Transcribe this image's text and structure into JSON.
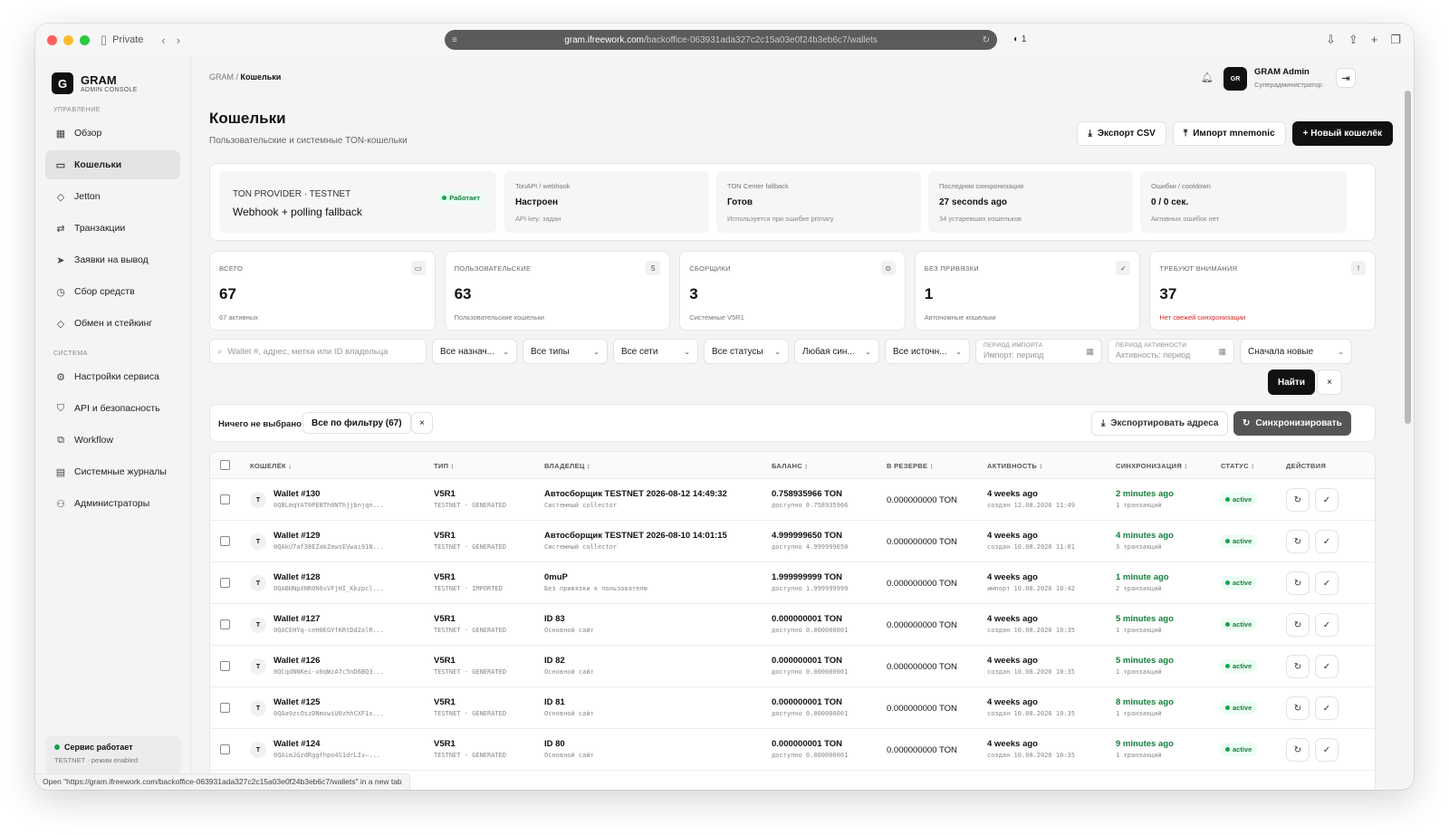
{
  "browser": {
    "private_label": "Private",
    "url_host": "gram.ifreework.com",
    "url_path": "/backoffice-063931ada327c2c15a03e0f24b3eb6c7/wallets",
    "ext_badge": "1",
    "hover_url": "Open \"https://gram.ifreework.com/backoffice-063931ada327c2c15a03e0f24b3eb6c7/wallets\" in a new tab"
  },
  "brand": {
    "letter": "G",
    "name": "GRAM",
    "sub": "ADMIN CONSOLE"
  },
  "sidebar": {
    "section1": "УПРАВЛЕНИЕ",
    "items1": [
      {
        "label": "Обзор",
        "icon": "grid-icon"
      },
      {
        "label": "Кошельки",
        "icon": "wallet-icon"
      },
      {
        "label": "Jetton",
        "icon": "diamond-icon"
      },
      {
        "label": "Транзакции",
        "icon": "arrows-icon"
      },
      {
        "label": "Заявки на вывод",
        "icon": "send-icon"
      },
      {
        "label": "Сбор средств",
        "icon": "clock-icon"
      },
      {
        "label": "Обмен и стейкинг",
        "icon": "diamond-icon"
      }
    ],
    "section2": "СИСТЕМА",
    "items2": [
      {
        "label": "Настройки сервиса",
        "icon": "gear-icon"
      },
      {
        "label": "API и безопасность",
        "icon": "shield-icon"
      },
      {
        "label": "Workflow",
        "icon": "workflow-icon"
      },
      {
        "label": "Системные журналы",
        "icon": "document-icon"
      },
      {
        "label": "Администраторы",
        "icon": "users-icon"
      }
    ],
    "service": {
      "title": "Сервис работает",
      "sub": "TESTNET · режим enabled"
    }
  },
  "header": {
    "breadcrumb_root": "GRAM / ",
    "breadcrumb_current": "Кошельки",
    "user_initials": "GR",
    "user_name": "GRAM Admin",
    "user_role": "Суперадминистратор"
  },
  "page": {
    "title": "Кошельки",
    "subtitle": "Пользовательские и системные TON-кошельки",
    "export_csv": "Экспорт CSV",
    "import_mnemonic": "Импорт mnemonic",
    "new_wallet": "+ Новый кошелёк"
  },
  "provider": {
    "label": "TON PROVIDER · TESTNET",
    "desc": "Webhook + polling fallback",
    "badge": "Работает",
    "cells": [
      {
        "label": "TonAPI / webhook",
        "value": "Настроен",
        "sub": "API key: задан"
      },
      {
        "label": "TON Center fallback",
        "value": "Готов",
        "sub": "Используется при ошибке primary"
      },
      {
        "label": "Последняя синхронизация",
        "value": "27 seconds ago",
        "sub": "34 устаревших кошельков"
      },
      {
        "label": "Ошибки / cooldown",
        "value": "0 / 0 сек.",
        "sub": "Активных ошибок нет"
      }
    ]
  },
  "stats": [
    {
      "label": "ВСЕГО",
      "value": "67",
      "sub": "67 активных",
      "icon": "wallet-icon",
      "glyph": "▭"
    },
    {
      "label": "ПОЛЬЗОВАТЕЛЬСКИЕ",
      "value": "63",
      "sub": "Пользовательские кошельки",
      "icon": "count-badge",
      "glyph": "5"
    },
    {
      "label": "СБОРЩИКИ",
      "value": "3",
      "sub": "Системные V5R1",
      "icon": "target-icon",
      "glyph": "⊙"
    },
    {
      "label": "БЕЗ ПРИВЯЗКИ",
      "value": "1",
      "sub": "Автономные кошельки",
      "icon": "check-icon",
      "glyph": "✓"
    },
    {
      "label": "ТРЕБУЮТ ВНИМАНИЯ",
      "value": "37",
      "sub": "Нет свежей синхронизации",
      "icon": "alert-icon",
      "glyph": "!"
    }
  ],
  "filters": {
    "search_placeholder": "Wallet #, адрес, метка или ID владельца",
    "selects": [
      "Все назнач...",
      "Все типы",
      "Все сети",
      "Все статусы",
      "Любая син...",
      "Все источн..."
    ],
    "import_label": "ПЕРИОД ИМПОРТА",
    "import_placeholder": "Импорт: период",
    "activity_label": "ПЕРИОД АКТИВНОСТИ",
    "activity_placeholder": "Активность: период",
    "sort": "Сначала новые",
    "find": "Найти",
    "clear": "×"
  },
  "selection": {
    "none": "Ничего не выбрано",
    "all_by_filter": "Все по фильтру (67)",
    "clear": "×",
    "export_addresses": "Экспортировать адреса",
    "sync": "Синхронизировать"
  },
  "table": {
    "headers": {
      "wallet": "КОШЕЛЁК ↓",
      "type": "ТИП ↕",
      "owner": "ВЛАДЕЛЕЦ ↕",
      "balance": "БАЛАНС ↕",
      "reserve": "В РЕЗЕРВЕ ↕",
      "activity": "АКТИВНОСТЬ ↕",
      "sync": "СИНХРОНИЗАЦИЯ ↕",
      "status": "СТАТУС ↕",
      "actions": "ДЕЙСТВИЯ"
    },
    "rows": [
      {
        "icon": "T",
        "name": "Wallet #130",
        "addr": "0QBLmqYAT0PEBTh0NThjjbnjqn...",
        "type": "V5R1",
        "type_sub": "TESTNET · GENERATED",
        "owner": "Автосборщик TESTNET 2026-08-12 14:49:32",
        "owner_sub": "Системный collector",
        "balance": "0.758935966 TON",
        "balance_sub": "доступно 0.758935966",
        "reserve": "0.000000000 TON",
        "activity": "4 weeks ago",
        "activity_sub": "создан 12.08.2026 11:49",
        "sync": "2 minutes ago",
        "sync_sub": "1 транзакций",
        "status": "active"
      },
      {
        "icon": "T",
        "name": "Wallet #129",
        "addr": "0QAkU7af38EZakZewsEVwai91N...",
        "type": "V5R1",
        "type_sub": "TESTNET · GENERATED",
        "owner": "Автосборщик TESTNET 2026-08-10 14:01:15",
        "owner_sub": "Системный collector",
        "balance": "4.999999650 TON",
        "balance_sub": "доступно 4.999999650",
        "reserve": "0.000000000 TON",
        "activity": "4 weeks ago",
        "activity_sub": "создан 10.08.2026 11:01",
        "sync": "4 minutes ago",
        "sync_sub": "3 транзакций",
        "status": "active"
      },
      {
        "icon": "T",
        "name": "Wallet #128",
        "addr": "0QABHNpXNR0N6sVFjHI_Kkzpcl...",
        "type": "V5R1",
        "type_sub": "TESTNET · IMPORTED",
        "owner": "0muP",
        "owner_sub": "Без привязки к пользователю",
        "balance": "1.999999999 TON",
        "balance_sub": "доступно 1.999999999",
        "reserve": "0.000000000 TON",
        "activity": "4 weeks ago",
        "activity_sub": "импорт 10.08.2026 10:42",
        "sync": "1 minute ago",
        "sync_sub": "2 транзакций",
        "status": "active"
      },
      {
        "icon": "T",
        "name": "Wallet #127",
        "addr": "0QACEHYq-ceH0EGYfKRtDd2alR...",
        "type": "V5R1",
        "type_sub": "TESTNET · GENERATED",
        "owner": "ID 83",
        "owner_sub": "Основной сайт",
        "balance": "0.000000001 TON",
        "balance_sub": "доступно 0.000000001",
        "reserve": "0.000000000 TON",
        "activity": "4 weeks ago",
        "activity_sub": "создан 10.08.2026 10:35",
        "sync": "5 minutes ago",
        "sync_sub": "1 транзакций",
        "status": "active"
      },
      {
        "icon": "T",
        "name": "Wallet #126",
        "addr": "0QCqdNNKei-x0qWzA7c5nD6BQ3...",
        "type": "V5R1",
        "type_sub": "TESTNET · GENERATED",
        "owner": "ID 82",
        "owner_sub": "Основной сайт",
        "balance": "0.000000001 TON",
        "balance_sub": "доступно 0.000000001",
        "reserve": "0.000000000 TON",
        "activity": "4 weeks ago",
        "activity_sub": "создан 10.08.2026 10:35",
        "sync": "5 minutes ago",
        "sync_sub": "1 транзакций",
        "status": "active"
      },
      {
        "icon": "T",
        "name": "Wallet #125",
        "addr": "0QAa9zcOszDNmxwiU0zhhCXF1x...",
        "type": "V5R1",
        "type_sub": "TESTNET · GENERATED",
        "owner": "ID 81",
        "owner_sub": "Основной сайт",
        "balance": "0.000000001 TON",
        "balance_sub": "доступно 0.000000001",
        "reserve": "0.000000000 TON",
        "activity": "4 weeks ago",
        "activity_sub": "создан 10.08.2026 10:35",
        "sync": "8 minutes ago",
        "sync_sub": "1 транзакций",
        "status": "active"
      },
      {
        "icon": "T",
        "name": "Wallet #124",
        "addr": "0QAimJGzdRggfhpo4S1drLIv—...",
        "type": "V5R1",
        "type_sub": "TESTNET · GENERATED",
        "owner": "ID 80",
        "owner_sub": "Основной сайт",
        "balance": "0.000000001 TON",
        "balance_sub": "доступно 0.000000001",
        "reserve": "0.000000000 TON",
        "activity": "4 weeks ago",
        "activity_sub": "создан 10.08.2026 10:35",
        "sync": "9 minutes ago",
        "sync_sub": "1 транзакций",
        "status": "active"
      }
    ]
  }
}
